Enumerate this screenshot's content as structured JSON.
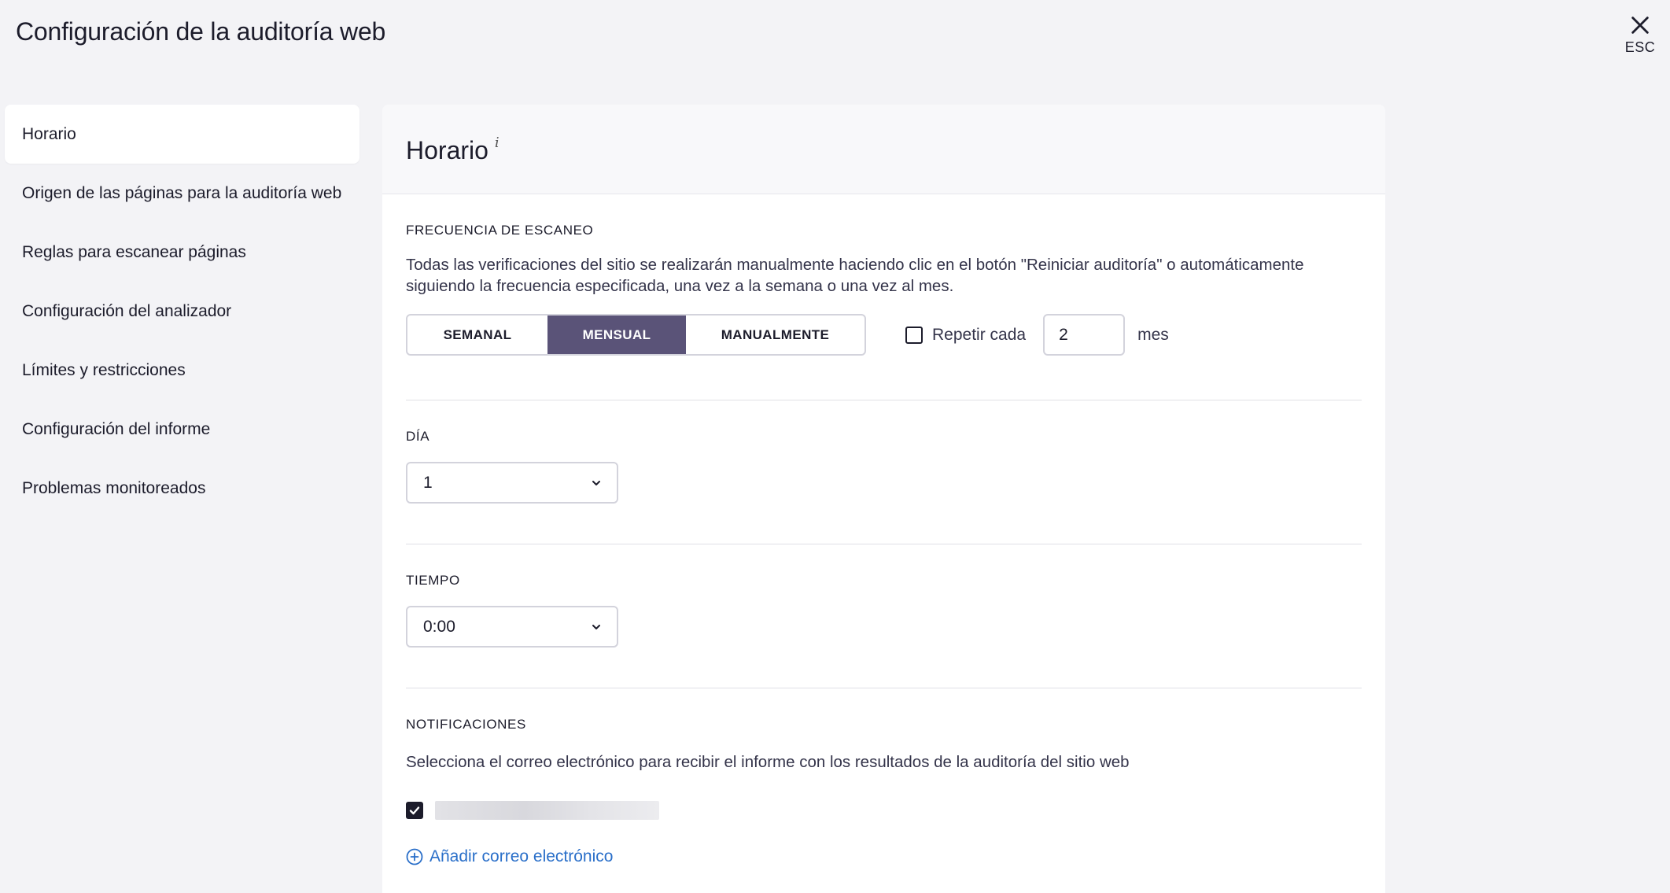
{
  "header": {
    "title": "Configuración de la auditoría web",
    "close_label": "ESC"
  },
  "sidebar": {
    "items": [
      {
        "label": "Horario",
        "active": true
      },
      {
        "label": "Origen de las páginas para la auditoría web"
      },
      {
        "label": "Reglas para escanear páginas"
      },
      {
        "label": "Configuración del analizador"
      },
      {
        "label": "Límites y restricciones"
      },
      {
        "label": "Configuración del informe"
      },
      {
        "label": "Problemas monitoreados"
      }
    ]
  },
  "main": {
    "title": "Horario",
    "info_mark": "i",
    "frequency": {
      "label": "FRECUENCIA DE ESCANEO",
      "description": "Todas las verificaciones del sitio se realizarán manualmente haciendo clic en el botón \"Reiniciar auditoría\" o automáticamente siguiendo la frecuencia especificada, una vez a la semana o una vez al mes.",
      "options": [
        "SEMANAL",
        "MENSUAL",
        "MANUALMENTE"
      ],
      "selected": "MENSUAL",
      "repeat_label": "Repetir cada",
      "repeat_checked": false,
      "repeat_value": "2",
      "repeat_unit": "mes"
    },
    "day": {
      "label": "DÍA",
      "value": "1"
    },
    "time": {
      "label": "TIEMPO",
      "value": "0:00"
    },
    "notifications": {
      "label": "NOTIFICACIONES",
      "description": "Selecciona el correo electrónico para recibir el informe con los resultados de la auditoría del sitio web",
      "email_checked": true,
      "add_email_label": "Añadir correo electrónico"
    }
  },
  "colors": {
    "accent": "#5a5378",
    "link": "#2a6fc9",
    "background": "#f3f3f6"
  }
}
